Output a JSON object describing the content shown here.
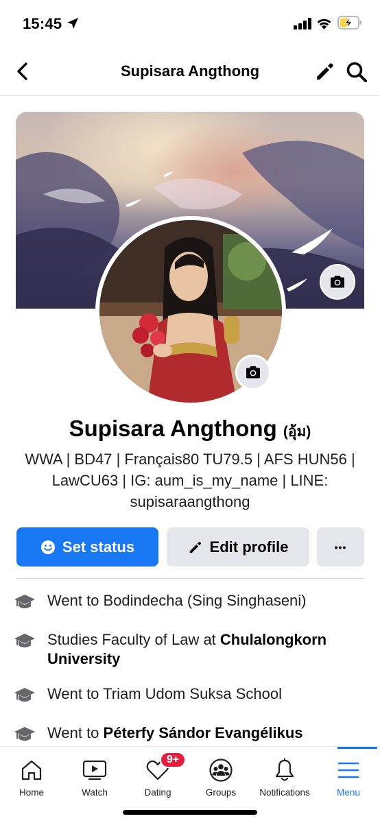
{
  "status_bar": {
    "time": "15:45",
    "icons": [
      "location-arrow-icon",
      "signal-icon",
      "wifi-icon",
      "battery-charging-icon"
    ]
  },
  "header": {
    "title": "Supisara Angthong",
    "back_icon": "chevron-left-icon",
    "edit_icon": "pencil-icon",
    "search_icon": "search-icon"
  },
  "profile": {
    "name": "Supisara Angthong",
    "nickname": "(อุ้ม)",
    "bio": "WWA | BD47 | Français80 TU79.5 | AFS HUN56 | LawCU63 | IG: aum_is_my_name | LINE: supisaraangthong"
  },
  "actions": {
    "set_status": "Set status",
    "edit_profile": "Edit profile",
    "more": "•••"
  },
  "intro": [
    {
      "prefix": "Went to Bodindecha (Sing Singhaseni)",
      "bold": ""
    },
    {
      "prefix": "Studies Faculty of Law at ",
      "bold": "Chulalongkorn University"
    },
    {
      "prefix": "Went to Triam Udom Suksa School",
      "bold": ""
    },
    {
      "prefix": "Went to ",
      "bold": "Péterfy Sándor Evangélikus"
    }
  ],
  "bottom_nav": {
    "items": [
      {
        "label": "Home",
        "icon": "home-icon"
      },
      {
        "label": "Watch",
        "icon": "video-icon"
      },
      {
        "label": "Dating",
        "icon": "heart-icon"
      },
      {
        "label": "Groups",
        "icon": "groups-icon"
      },
      {
        "label": "Notifications",
        "icon": "bell-icon"
      },
      {
        "label": "Menu",
        "icon": "hamburger-menu-icon"
      }
    ],
    "active": "Menu",
    "dating_badge": "9+"
  },
  "colors": {
    "accent": "#1877f2",
    "badge": "#e41e3f",
    "secondary_button": "#e4e6eb"
  }
}
